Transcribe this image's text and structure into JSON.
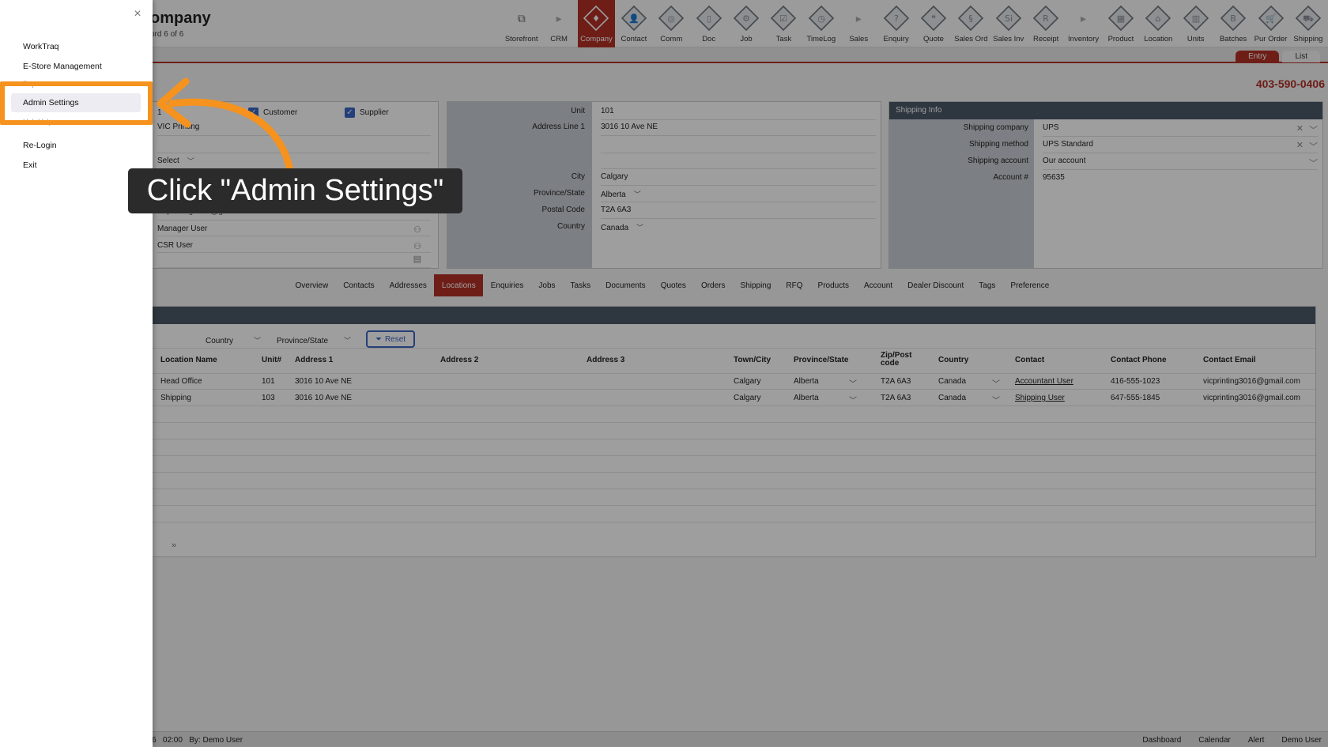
{
  "app": {
    "title": "ompany",
    "record_count": "ord 6 of 6",
    "phone": "403-590-0406"
  },
  "nav": [
    {
      "label": "Storefront",
      "icon": "external-link-icon"
    },
    {
      "label": "CRM",
      "icon": "chevron-right-icon",
      "separator": true
    },
    {
      "label": "Company",
      "icon": "company-icon",
      "active": true
    },
    {
      "label": "Contact",
      "icon": "contact-icon"
    },
    {
      "label": "Comm",
      "icon": "comm-icon"
    },
    {
      "label": "Doc",
      "icon": "doc-icon"
    },
    {
      "label": "Job",
      "icon": "job-icon"
    },
    {
      "label": "Task",
      "icon": "task-icon"
    },
    {
      "label": "TimeLog",
      "icon": "timelog-icon"
    },
    {
      "label": "Sales",
      "icon": "chevron-right-icon",
      "separator": true
    },
    {
      "label": "Enquiry",
      "icon": "enquiry-icon"
    },
    {
      "label": "Quote",
      "icon": "quote-icon"
    },
    {
      "label": "Sales Ord",
      "icon": "sales-order-icon"
    },
    {
      "label": "Sales Inv",
      "icon": "sales-invoice-icon"
    },
    {
      "label": "Receipt",
      "icon": "receipt-icon"
    },
    {
      "label": "Inventory",
      "icon": "chevron-right-icon",
      "separator": true
    },
    {
      "label": "Product",
      "icon": "product-icon"
    },
    {
      "label": "Location",
      "icon": "location-icon"
    },
    {
      "label": "Units",
      "icon": "units-icon"
    },
    {
      "label": "Batches",
      "icon": "batches-icon"
    },
    {
      "label": "Pur Order",
      "icon": "purchase-order-icon"
    },
    {
      "label": "Shipping",
      "icon": "shipping-icon"
    }
  ],
  "view_tabs": {
    "entry": "Entry",
    "list": "List"
  },
  "company_panel": {
    "id_fragment": "1",
    "customer_label": "Customer",
    "supplier_label": "Supplier",
    "name_fragment": "VIC Printing",
    "select_label": "Select",
    "phone_fragment": "403-590-0406",
    "email_fragment": "vicprinting3016@gmail.com",
    "manager": "Manager User",
    "csr": "CSR User"
  },
  "address_panel": {
    "unit_label": "Unit",
    "unit": "101",
    "address1_label": "Address Line 1",
    "address1": "3016 10 Ave NE",
    "city_label": "City",
    "city": "Calgary",
    "province_label": "Province/State",
    "province": "Alberta",
    "postal_label": "Postal Code",
    "postal": "T2A 6A3",
    "country_label": "Country",
    "country": "Canada"
  },
  "shipping_panel": {
    "header": "Shipping Info",
    "company_label": "Shipping company",
    "company": "UPS",
    "method_label": "Shipping method",
    "method": "UPS Standard",
    "account_label": "Shipping account",
    "account": "Our account",
    "account_no_label": "Account #",
    "account_no": "95635"
  },
  "subtabs": [
    "Overview",
    "Contacts",
    "Addresses",
    "Locations",
    "Enquiries",
    "Jobs",
    "Tasks",
    "Documents",
    "Quotes",
    "Orders",
    "Shipping",
    "RFQ",
    "Products",
    "Account",
    "Dealer Discount",
    "Tags",
    "Preference"
  ],
  "active_subtab": "Locations",
  "filters": {
    "country": "Country",
    "province": "Province/State",
    "reset": "Reset"
  },
  "table": {
    "columns": [
      "Location Name",
      "Unit#",
      "Address 1",
      "Address 2",
      "Address 3",
      "Town/City",
      "Province/State",
      "Zip/Post code",
      "Country",
      "Contact",
      "Contact Phone",
      "Contact Email"
    ],
    "rows": [
      [
        "Head Office",
        "101",
        "3016 10 Ave NE",
        "",
        "",
        "Calgary",
        "Alberta",
        "T2A 6A3",
        "Canada",
        "Accountant User",
        "416-555-1023",
        "vicprinting3016@gmail.com"
      ],
      [
        "Shipping",
        "103",
        "3016 10 Ave NE",
        "",
        "",
        "Calgary",
        "Alberta",
        "T2A 6A3",
        "Canada",
        "Shipping User",
        "647-555-1845",
        "vicprinting3016@gmail.com"
      ]
    ],
    "pager": "»"
  },
  "status": {
    "left": "6   02:00   By: Demo User",
    "right": [
      "Dashboard",
      "Calendar",
      "Alert",
      "Demo User"
    ]
  },
  "drawer": {
    "items": [
      "WorkTraq",
      "E-Store Management",
      "Reports",
      "Admin Settings",
      "Hub Help",
      "Re-Login",
      "Exit"
    ],
    "highlighted": "Admin Settings"
  },
  "annotation": {
    "callout": "Click \"Admin Settings\"",
    "color": "#f6921e"
  },
  "colors": {
    "brand": "#b23126",
    "header": "#4b5768",
    "accent": "#3a66c4"
  }
}
